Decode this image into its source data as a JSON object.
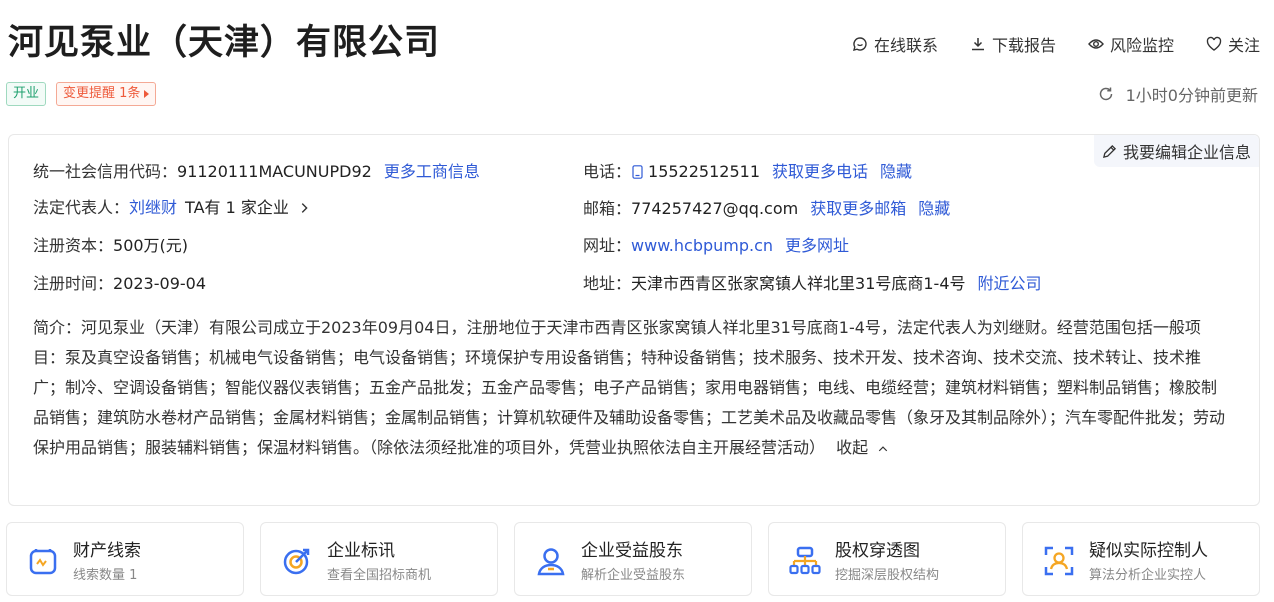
{
  "header": {
    "company_name": "河见泵业（天津）有限公司",
    "actions": {
      "contact": "在线联系",
      "download": "下载报告",
      "monitor": "风险监控",
      "follow": "关注"
    },
    "status_tag": "开业",
    "change_tag": "变更提醒 1条",
    "update_time": "1小时0分钟前更新"
  },
  "info": {
    "edit_label": "我要编辑企业信息",
    "credit_code_label": "统一社会信用代码：",
    "credit_code_value": "91120111MACUNUPD92",
    "more_business_link": "更多工商信息",
    "legal_rep_label": "法定代表人：",
    "legal_rep_name": "刘继财",
    "legal_rep_companies": "TA有 1 家企业",
    "capital_label": "注册资本：",
    "capital_value": "500万(元)",
    "reg_time_label": "注册时间：",
    "reg_time_value": "2023-09-04",
    "phone_label": "电话：",
    "phone_value": "15522512511",
    "phone_more_link": "获取更多电话",
    "phone_hide_link": "隐藏",
    "email_label": "邮箱：",
    "email_value": "774257427@qq.com",
    "email_more_link": "获取更多邮箱",
    "email_hide_link": "隐藏",
    "website_label": "网址：",
    "website_value": "www.hcbpump.cn",
    "website_more_link": "更多网址",
    "address_label": "地址：",
    "address_value": "天津市西青区张家窝镇人祥北里31号底商1-4号",
    "nearby_link": "附近公司",
    "intro_text": "简介：河见泵业（天津）有限公司成立于2023年09月04日，注册地位于天津市西青区张家窝镇人祥北里31号底商1-4号，法定代表人为刘继财。经营范围包括一般项目：泵及真空设备销售；机械电气设备销售；电气设备销售；环境保护专用设备销售；特种设备销售；技术服务、技术开发、技术咨询、技术交流、技术转让、技术推广；制冷、空调设备销售；智能仪器仪表销售；五金产品批发；五金产品零售；电子产品销售；家用电器销售；电线、电缆经营；建筑材料销售；塑料制品销售；橡胶制品销售；建筑防水卷材产品销售；金属材料销售；金属制品销售；计算机软硬件及辅助设备零售；工艺美术品及收藏品零售（象牙及其制品除外）；汽车零配件批发；劳动保护用品销售；服装辅料销售；保温材料销售。（除依法须经批准的项目外，凭营业执照依法自主开展经营活动）",
    "collapse_label": "收起"
  },
  "cards": [
    {
      "title": "财产线索",
      "subtitle": "线索数量 1",
      "icon": "property-clue-icon"
    },
    {
      "title": "企业标讯",
      "subtitle": "查看全国招标商机",
      "icon": "bidding-target-icon"
    },
    {
      "title": "企业受益股东",
      "subtitle": "解析企业受益股东",
      "icon": "beneficiary-person-icon"
    },
    {
      "title": "股权穿透图",
      "subtitle": "挖掘深层股权结构",
      "icon": "equity-tree-icon"
    },
    {
      "title": "疑似实际控制人",
      "subtitle": "算法分析企业实控人",
      "icon": "controller-scan-icon"
    }
  ],
  "colors": {
    "link": "#2f5ad6",
    "icon_blue": "#3a6ff0",
    "tag_green": "#1ea06e",
    "tag_red": "#ee5a3b"
  }
}
